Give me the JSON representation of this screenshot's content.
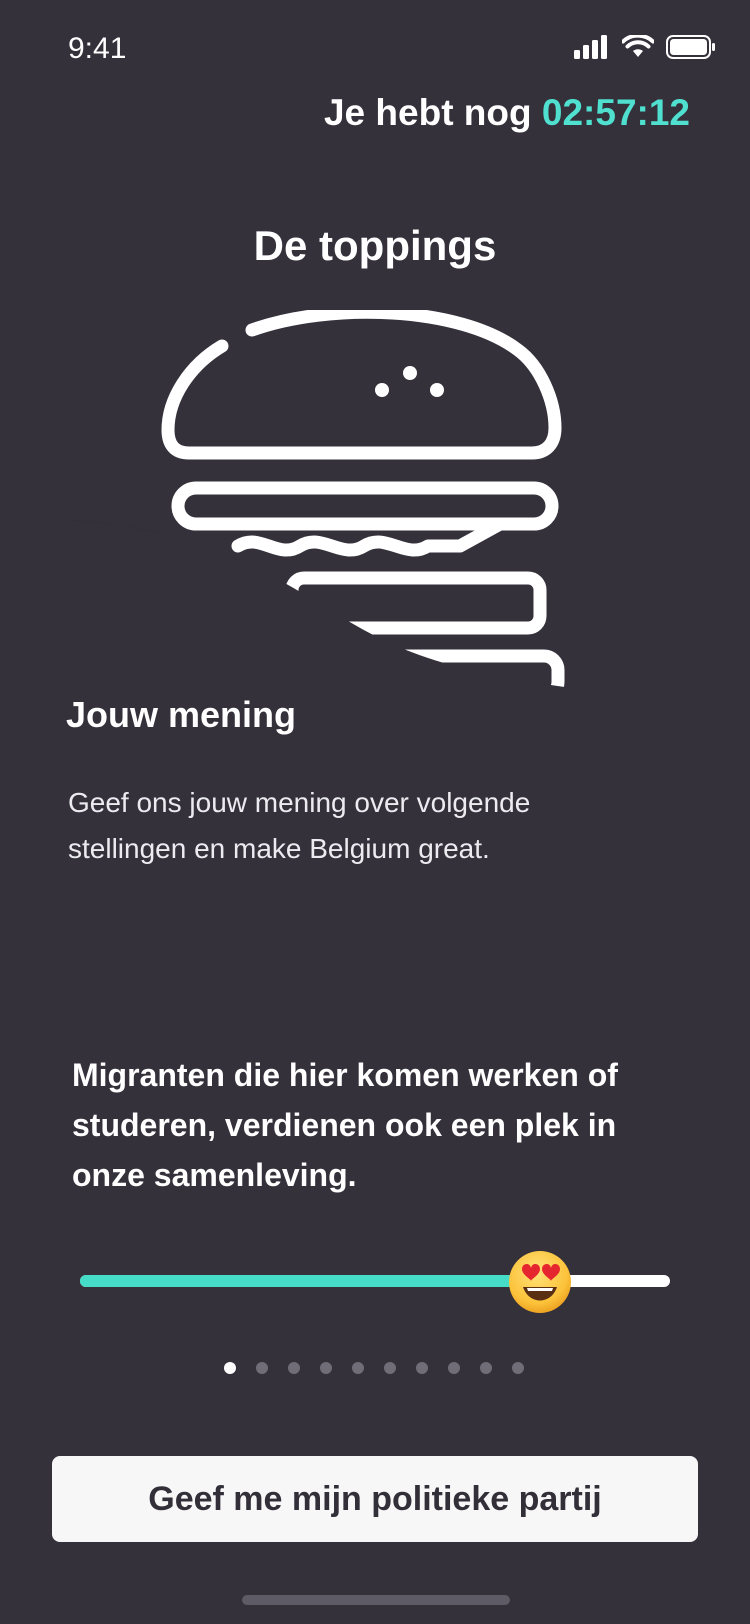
{
  "status_bar": {
    "time": "9:41",
    "icons": [
      "signal-icon",
      "wifi-icon",
      "battery-icon"
    ]
  },
  "timer": {
    "prefix": "Je hebt nog",
    "value": "02:57:12"
  },
  "title": "De toppings",
  "section": {
    "heading": "Jouw mening",
    "body": "Geef ons jouw mening over volgende stellingen en make Belgium great."
  },
  "statement": "Migranten die hier komen werken of studeren, verdienen ook een plek in onze samenleving.",
  "slider": {
    "value": 0.78,
    "thumb_icon": "heart-eyes-emoji-icon"
  },
  "pagination": {
    "total": 10,
    "active_index": 0
  },
  "cta": {
    "label": "Geef me mijn politieke partij"
  },
  "colors": {
    "background": "#34313b",
    "accent": "#4fe0cf",
    "button_bg": "#f7f7f8",
    "button_text": "#322f38"
  }
}
